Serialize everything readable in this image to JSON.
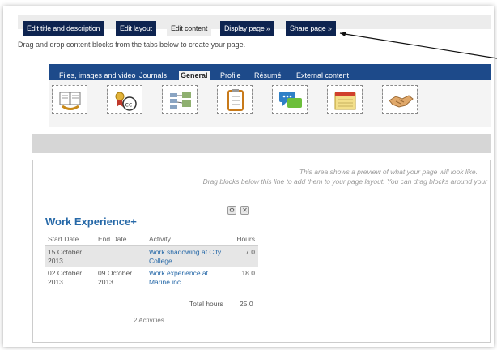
{
  "top_tabs": [
    {
      "label": "Edit title and description"
    },
    {
      "label": "Edit layout"
    },
    {
      "label": "Edit content"
    },
    {
      "label": "Display page »"
    },
    {
      "label": "Share page »"
    }
  ],
  "instructions": "Drag and drop content blocks from the tabs below to create your page.",
  "palette_tabs": [
    {
      "label": "Files, images and video"
    },
    {
      "label": "Journals"
    },
    {
      "label": "General"
    },
    {
      "label": "Profile"
    },
    {
      "label": "Résumé"
    },
    {
      "label": "External content"
    }
  ],
  "blocks": [
    {
      "icon": "book-icon"
    },
    {
      "icon": "creative-commons-icon"
    },
    {
      "icon": "navigation-icon"
    },
    {
      "icon": "checklist-icon"
    },
    {
      "icon": "chat-icon"
    },
    {
      "icon": "note-icon"
    },
    {
      "icon": "handshake-icon"
    }
  ],
  "preview": {
    "hint_line1": "This area shows a preview of what your page will look like.",
    "hint_line2": "Drag blocks below this line to add them to your page layout. You can drag blocks around your"
  },
  "block": {
    "title": "Work Experience+",
    "columns": [
      "Start Date",
      "End Date",
      "Activity",
      "Hours"
    ],
    "rows": [
      {
        "start_date": "15 October 2013",
        "end_date": "",
        "activity": "Work shadowing at City College",
        "hours": "7.0"
      },
      {
        "start_date": "02 October 2013",
        "end_date": "09 October 2013",
        "activity": "Work experience at Marine inc",
        "hours": "18.0"
      }
    ],
    "total_label": "Total hours",
    "total_value": "25.0",
    "count": "2 Activities"
  },
  "colors": {
    "tab_dark": "#0e2450",
    "palette_blue": "#1d4a8a",
    "link_blue": "#2769a8"
  }
}
